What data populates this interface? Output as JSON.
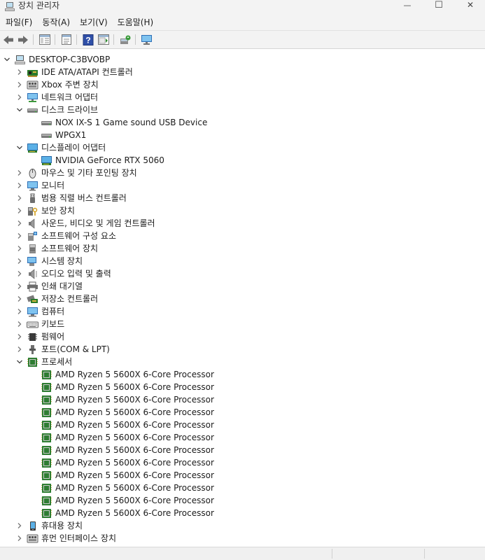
{
  "window": {
    "title": "장치 관리자",
    "minimize_glyph": "—",
    "maximize_glyph": "☐",
    "close_glyph": "✕"
  },
  "menu": [
    {
      "label": "파일(F)"
    },
    {
      "label": "동작(A)"
    },
    {
      "label": "보기(V)"
    },
    {
      "label": "도움말(H)"
    }
  ],
  "toolbar": {
    "icons": [
      "back-arrow-icon",
      "forward-arrow-icon",
      "show-hide-console-tree-icon",
      "properties-icon",
      "help-icon",
      "action-pane-icon",
      "scan-hardware-icon",
      "monitor-display-icon"
    ]
  },
  "tree": {
    "root": {
      "label": "DESKTOP-C3BVOBP",
      "icon": "computer-icon"
    },
    "categories": [
      {
        "label": "IDE ATA/ATAPI 컨트롤러",
        "icon": "ide-controller-icon",
        "expanded": false
      },
      {
        "label": "Xbox 주변 장치",
        "icon": "xbox-peripheral-icon",
        "expanded": false
      },
      {
        "label": "네트워크 어댑터",
        "icon": "network-adapter-icon",
        "expanded": false
      },
      {
        "label": "디스크 드라이브",
        "icon": "disk-drive-icon",
        "expanded": true,
        "children": [
          {
            "label": "NOX IX-S 1  Game sound USB Device",
            "icon": "disk-drive-icon"
          },
          {
            "label": "WPGX1",
            "icon": "disk-drive-icon"
          }
        ]
      },
      {
        "label": "디스플레이 어댑터",
        "icon": "display-adapter-icon",
        "expanded": true,
        "children": [
          {
            "label": "NVIDIA GeForce RTX 5060",
            "icon": "display-adapter-icon"
          }
        ]
      },
      {
        "label": "마우스 및 기타 포인팅 장치",
        "icon": "mouse-icon",
        "expanded": false
      },
      {
        "label": "모니터",
        "icon": "monitor-icon",
        "expanded": false
      },
      {
        "label": "범용 직렬 버스 컨트롤러",
        "icon": "usb-icon",
        "expanded": false
      },
      {
        "label": "보안 장치",
        "icon": "security-device-icon",
        "expanded": false
      },
      {
        "label": "사운드, 비디오 및 게임 컨트롤러",
        "icon": "speaker-icon",
        "expanded": false
      },
      {
        "label": "소프트웨어 구성 요소",
        "icon": "software-component-icon",
        "expanded": false
      },
      {
        "label": "소프트웨어 장치",
        "icon": "software-device-icon",
        "expanded": false
      },
      {
        "label": "시스템 장치",
        "icon": "system-device-icon",
        "expanded": false
      },
      {
        "label": "오디오 입력 및 출력",
        "icon": "audio-io-icon",
        "expanded": false
      },
      {
        "label": "인쇄 대기열",
        "icon": "printer-icon",
        "expanded": false
      },
      {
        "label": "저장소 컨트롤러",
        "icon": "storage-controller-icon",
        "expanded": false
      },
      {
        "label": "컴퓨터",
        "icon": "computer-monitor-icon",
        "expanded": false
      },
      {
        "label": "키보드",
        "icon": "keyboard-icon",
        "expanded": false
      },
      {
        "label": "펌웨어",
        "icon": "firmware-icon",
        "expanded": false
      },
      {
        "label": "포트(COM & LPT)",
        "icon": "port-icon",
        "expanded": false
      },
      {
        "label": "프로세서",
        "icon": "processor-icon",
        "expanded": true,
        "children": [
          {
            "label": "AMD Ryzen 5 5600X 6-Core Processor",
            "icon": "processor-icon"
          },
          {
            "label": "AMD Ryzen 5 5600X 6-Core Processor",
            "icon": "processor-icon"
          },
          {
            "label": "AMD Ryzen 5 5600X 6-Core Processor",
            "icon": "processor-icon"
          },
          {
            "label": "AMD Ryzen 5 5600X 6-Core Processor",
            "icon": "processor-icon"
          },
          {
            "label": "AMD Ryzen 5 5600X 6-Core Processor",
            "icon": "processor-icon"
          },
          {
            "label": "AMD Ryzen 5 5600X 6-Core Processor",
            "icon": "processor-icon"
          },
          {
            "label": "AMD Ryzen 5 5600X 6-Core Processor",
            "icon": "processor-icon"
          },
          {
            "label": "AMD Ryzen 5 5600X 6-Core Processor",
            "icon": "processor-icon"
          },
          {
            "label": "AMD Ryzen 5 5600X 6-Core Processor",
            "icon": "processor-icon"
          },
          {
            "label": "AMD Ryzen 5 5600X 6-Core Processor",
            "icon": "processor-icon"
          },
          {
            "label": "AMD Ryzen 5 5600X 6-Core Processor",
            "icon": "processor-icon"
          },
          {
            "label": "AMD Ryzen 5 5600X 6-Core Processor",
            "icon": "processor-icon"
          }
        ]
      },
      {
        "label": "휴대용 장치",
        "icon": "portable-device-icon",
        "expanded": false
      },
      {
        "label": "휴먼 인터페이스 장치",
        "icon": "human-interface-device-icon",
        "expanded": false
      }
    ]
  }
}
